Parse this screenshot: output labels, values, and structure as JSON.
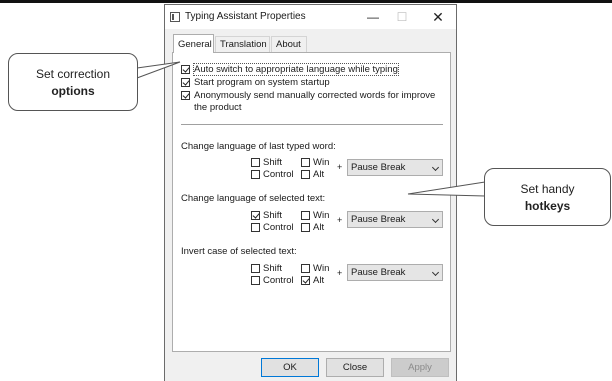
{
  "window": {
    "title": "Typing Assistant Properties",
    "controls": {
      "minimize": "—",
      "maximize": "☐",
      "close": "✕"
    }
  },
  "tabs": [
    {
      "label": "General",
      "active": true
    },
    {
      "label": "Translation",
      "active": false
    },
    {
      "label": "About",
      "active": false
    }
  ],
  "options": [
    {
      "label": "Auto switch to appropriate language while typing",
      "checked": true
    },
    {
      "label": "Start program on system startup",
      "checked": true
    },
    {
      "label": "Anonymously send manually corrected words for improve",
      "label2": "the product",
      "checked": true
    }
  ],
  "hotkeys": [
    {
      "title": "Change language of last typed word:",
      "shift": {
        "label": "Shift",
        "checked": false
      },
      "win": {
        "label": "Win",
        "checked": false
      },
      "control": {
        "label": "Control",
        "checked": false
      },
      "alt": {
        "label": "Alt",
        "checked": false
      },
      "plus": "+",
      "key": "Pause Break"
    },
    {
      "title": "Change language of selected text:",
      "shift": {
        "label": "Shift",
        "checked": true
      },
      "win": {
        "label": "Win",
        "checked": false
      },
      "control": {
        "label": "Control",
        "checked": false
      },
      "alt": {
        "label": "Alt",
        "checked": false
      },
      "plus": "+",
      "key": "Pause Break"
    },
    {
      "title": "Invert case of selected text:",
      "shift": {
        "label": "Shift",
        "checked": false
      },
      "win": {
        "label": "Win",
        "checked": false
      },
      "control": {
        "label": "Control",
        "checked": false
      },
      "alt": {
        "label": "Alt",
        "checked": true
      },
      "plus": "+",
      "key": "Pause Break"
    }
  ],
  "buttons": {
    "ok": "OK",
    "close": "Close",
    "apply": "Apply"
  },
  "callouts": {
    "left": {
      "line1": "Set correction",
      "line2": "options"
    },
    "right": {
      "line1": "Set handy",
      "line2": "hotkeys"
    }
  }
}
